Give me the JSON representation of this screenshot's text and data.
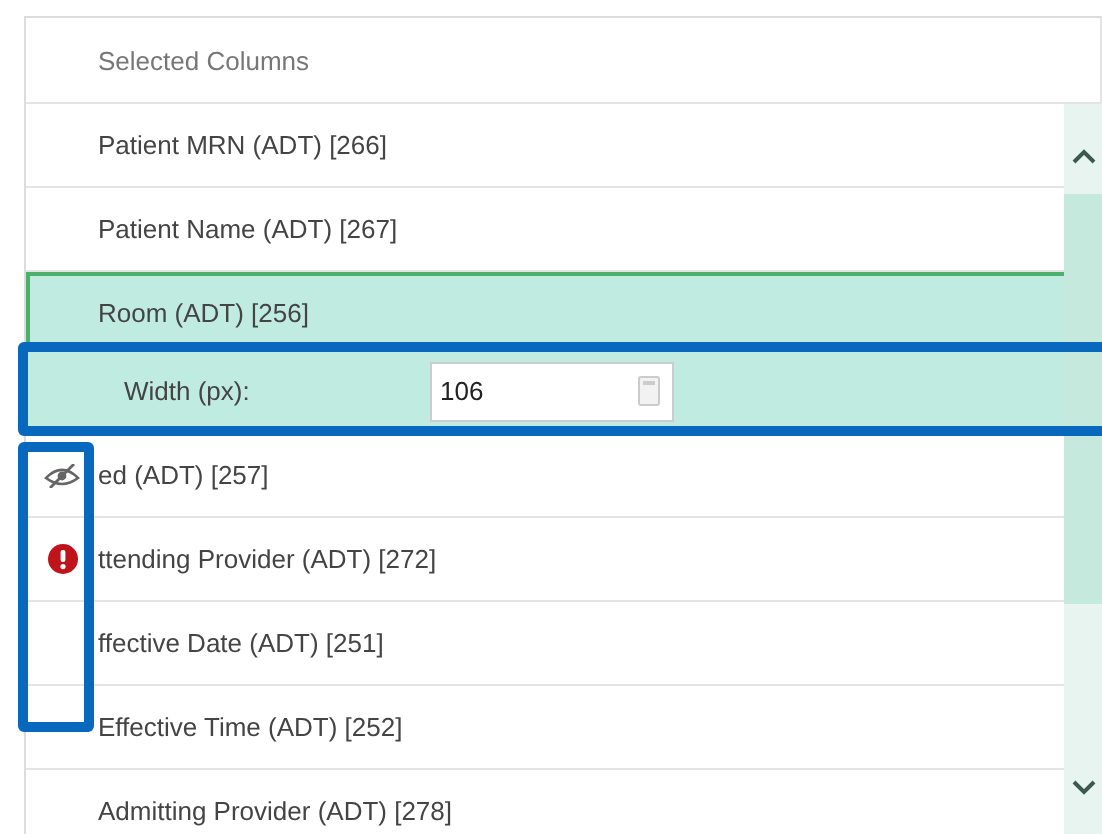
{
  "header": "Selected Columns",
  "rows": [
    {
      "label": "Patient MRN (ADT) [266]",
      "selected": false
    },
    {
      "label": "Patient Name (ADT) [267]",
      "selected": false
    },
    {
      "label": "Room (ADT) [256]",
      "selected": true,
      "width_editor": {
        "label": "Width (px):",
        "value": "106"
      }
    },
    {
      "label": "ed (ADT) [257]",
      "selected": false,
      "kind": "hidden"
    },
    {
      "label": "ttending Provider (ADT) [272]",
      "selected": false,
      "kind": "error"
    },
    {
      "label": "ffective Date (ADT) [251]",
      "selected": false
    },
    {
      "label": "Effective Time (ADT) [252]",
      "selected": false
    },
    {
      "label": "Admitting Provider (ADT) [278]",
      "selected": false
    }
  ]
}
